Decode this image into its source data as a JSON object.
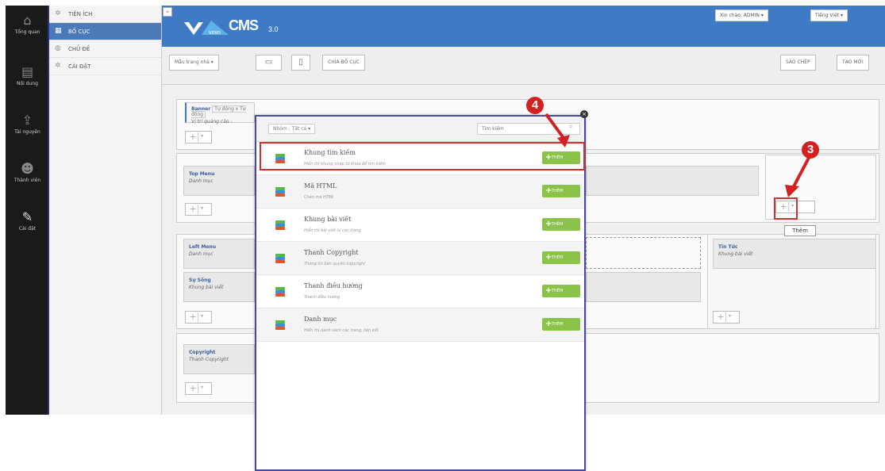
{
  "leftbar": {
    "items": [
      {
        "label": "Tổng quan",
        "icon": "home-icon"
      },
      {
        "label": "Nội dung",
        "icon": "document-icon"
      },
      {
        "label": "Tài nguyên",
        "icon": "upload-icon"
      },
      {
        "label": "Thành viên",
        "icon": "users-icon"
      },
      {
        "label": "Cài đặt",
        "icon": "wrench-icon"
      }
    ]
  },
  "submenu": {
    "items": [
      {
        "label": "TIỆN ÍCH"
      },
      {
        "label": "BỐ CỤC"
      },
      {
        "label": "CHỦ ĐỀ"
      },
      {
        "label": "CÀI ĐẶT"
      }
    ]
  },
  "header": {
    "logo_text": "CMS",
    "logo_version": "3.0",
    "logo_brand": "vnvn",
    "user_greeting": "Xin chào, ADMIN",
    "language": "Tiếng Việt"
  },
  "toolbar": {
    "template_select": "Mẫu trang nhà",
    "split_layout": "CHIA BỐ CỤC",
    "copy": "SAO CHÉP",
    "new": "TẠO MỚI"
  },
  "layout": {
    "banner_title": "Banner",
    "banner_tag": "Tự động x Tự động",
    "banner_sub": "Vị trí quảng cáo -",
    "top_menu_title": "Top Menu",
    "top_menu_sub": "Danh mục",
    "left_menu_title": "Left Menu",
    "left_menu_sub": "Danh mục",
    "su_song_title": "Sự Sống",
    "su_song_sub": "Khung bài viết",
    "tin_tuc_title": "Tin Tức",
    "tin_tuc_sub": "Khung bài viết",
    "copyright_title": "Copyright",
    "copyright_sub": "Thanh Copyright"
  },
  "popup": {
    "filter": "Nhóm : Tất cả",
    "search_placeholder": "Tìm kiếm",
    "add_label": "THÊM",
    "items": [
      {
        "name": "Khung tìm kiếm",
        "desc": "Hiển thị khung nhập từ khóa để tìm kiếm"
      },
      {
        "name": "Mã HTML",
        "desc": "Chèn mã HTML"
      },
      {
        "name": "Khung bài viết",
        "desc": "Hiển thị bài viết từ các trang"
      },
      {
        "name": "Thanh Copyright",
        "desc": "Thông tin bản quyền copyright"
      },
      {
        "name": "Thanh điều hướng",
        "desc": "Thanh điều hướng"
      },
      {
        "name": "Danh mục",
        "desc": "Hiển thị danh sách các trang, liên kết"
      }
    ]
  },
  "annotations": {
    "step3": "3",
    "step4": "4",
    "tooltip": "Thêm"
  },
  "colors": {
    "accent": "#3e7bc4",
    "highlight": "#d23030",
    "add_button": "#8bc34a"
  }
}
